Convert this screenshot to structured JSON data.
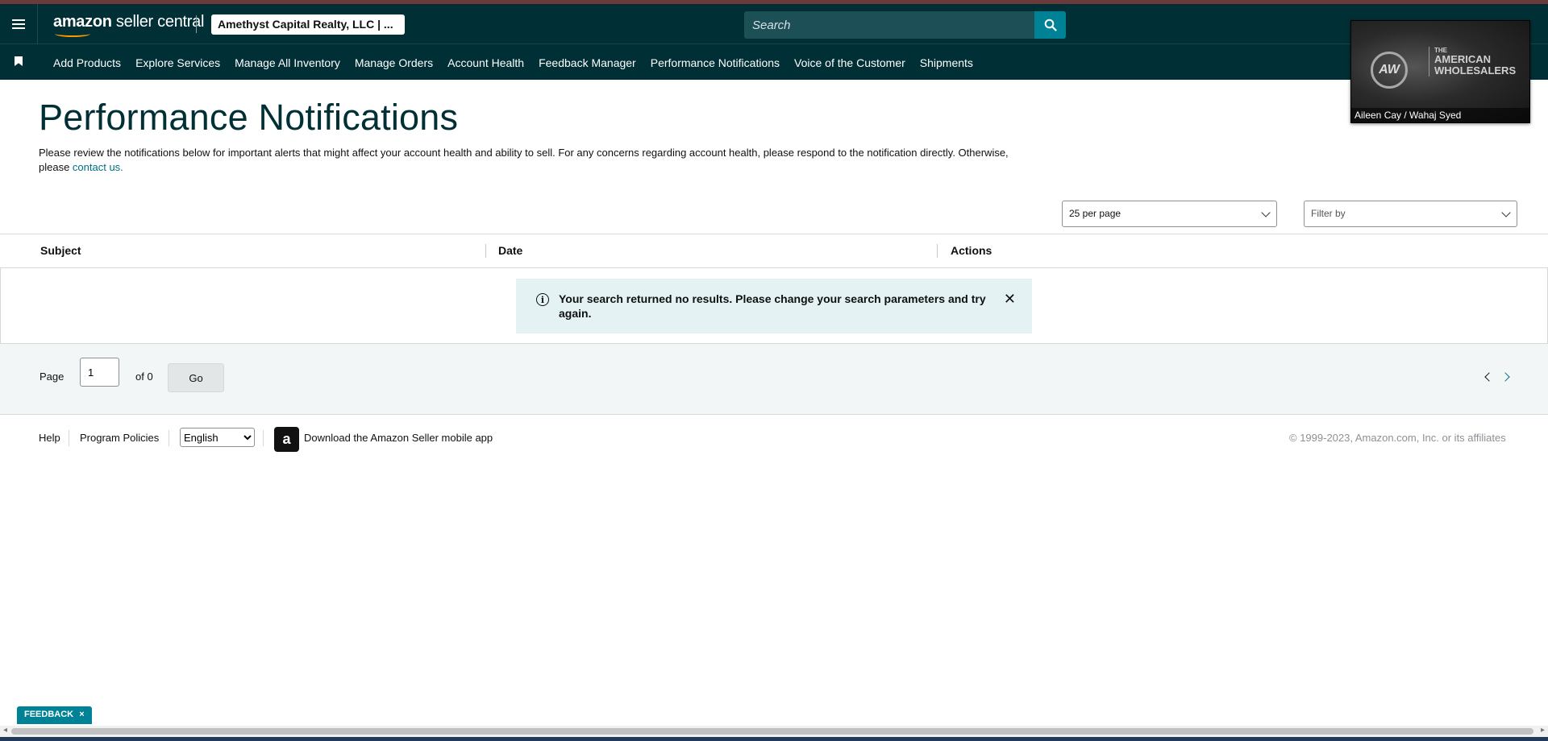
{
  "header": {
    "logo_bold": "amazon",
    "logo_text": " seller central",
    "account": "Amethyst Capital Realty, LLC | ...",
    "search_placeholder": "Search"
  },
  "nav": {
    "items": [
      "Add Products",
      "Explore Services",
      "Manage All Inventory",
      "Manage Orders",
      "Account Health",
      "Feedback Manager",
      "Performance Notifications",
      "Voice of the Customer",
      "Shipments"
    ]
  },
  "video_overlay": {
    "logo_letters": "AW",
    "logo_line1": "THE",
    "logo_line2": "AMERICAN",
    "logo_line3": "WHOLESALERS",
    "caption": "Aileen Cay / Wahaj Syed"
  },
  "page": {
    "title": "Performance Notifications",
    "intro": "Please review the notifications below for important alerts that might affect your account health and ability to sell. For any concerns regarding account health, please respond to the notification directly. Otherwise, please ",
    "contact_link": "contact us."
  },
  "controls": {
    "per_page": "25 per page",
    "filter": "Filter by"
  },
  "table": {
    "columns": [
      "Subject",
      "Date",
      "Actions"
    ],
    "alert": "Your search returned no results. Please change your search parameters and try again."
  },
  "pager": {
    "label": "Page",
    "current": "1",
    "of": "of 0",
    "go": "Go"
  },
  "footer": {
    "help": "Help",
    "policies": "Program Policies",
    "language": "English",
    "app_link": "Download the Amazon Seller mobile app",
    "copyright": "© 1999-2023, Amazon.com, Inc. or its affiliates"
  },
  "feedback": {
    "label": "FEEDBACK",
    "close": "×"
  },
  "colors": {
    "header_bg": "#002f36",
    "accent": "#008296",
    "link": "#007185",
    "alert_bg": "#e4f2f3"
  },
  "icons": [
    "hamburger-icon",
    "search-icon",
    "bookmark-icon",
    "info-icon",
    "close-icon",
    "chevron-down-icon",
    "chevron-left-icon",
    "chevron-right-icon",
    "amazon-app-icon"
  ]
}
